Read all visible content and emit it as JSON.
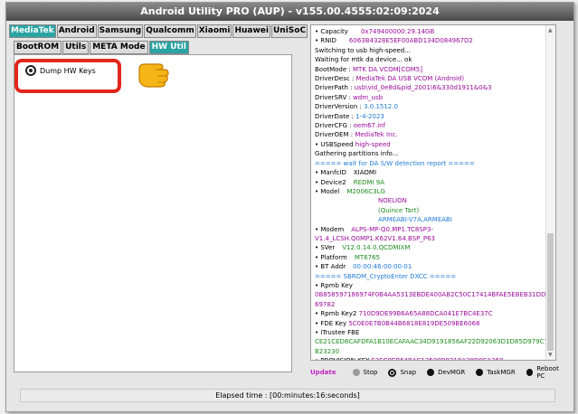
{
  "window": {
    "title": "Android Utility PRO (AUP) - v155.00.4555:02:09:2024"
  },
  "main_tabs": [
    {
      "label": "MediaTek",
      "active": true
    },
    {
      "label": "Android",
      "active": false
    },
    {
      "label": "Samsung",
      "active": false
    },
    {
      "label": "Qualcomm",
      "active": false
    },
    {
      "label": "Xiaomi",
      "active": false
    },
    {
      "label": "Huawei",
      "active": false
    },
    {
      "label": "UniSoC",
      "active": false
    }
  ],
  "sub_tabs": [
    {
      "label": "BootROM",
      "active": false
    },
    {
      "label": "Utils",
      "active": false
    },
    {
      "label": "META Mode",
      "active": false
    },
    {
      "label": "HW Util",
      "active": true
    }
  ],
  "hw_util": {
    "dump_hw_keys_label": "Dump HW Keys",
    "selected": true
  },
  "log": [
    {
      "parts": [
        {
          "t": "• Capacity",
          "c": "k"
        },
        {
          "t": "0x749400000:29.14GB",
          "c": "v",
          "tab": 2
        }
      ]
    },
    {
      "parts": [
        {
          "t": "• RNID",
          "c": "k"
        },
        {
          "t": "6063B4328E5EF00ABD134D084967D2",
          "c": "v",
          "tab": 2
        }
      ]
    },
    {
      "parts": [
        {
          "t": "Switching to usb high-speed...",
          "c": "k"
        }
      ]
    },
    {
      "parts": [
        {
          "t": "Waiting for mtk da device... ok",
          "c": "k"
        }
      ]
    },
    {
      "parts": [
        {
          "t": "BootMode : ",
          "c": "k"
        },
        {
          "t": "MTK DA VCOM[COM5]",
          "c": "v"
        }
      ]
    },
    {
      "parts": [
        {
          "t": "DriverDesc : ",
          "c": "k"
        },
        {
          "t": "MediaTek DA USB VCOM (Android)",
          "c": "v"
        }
      ]
    },
    {
      "parts": [
        {
          "t": "DriverPath : ",
          "c": "k"
        },
        {
          "t": "usb\\vid_0e8d&pid_2001\\6&330d1911&0&3",
          "c": "v"
        }
      ]
    },
    {
      "parts": [
        {
          "t": "DriverSRV : ",
          "c": "k"
        },
        {
          "t": "wdm_usb",
          "c": "v"
        }
      ]
    },
    {
      "parts": [
        {
          "t": "DriverVersion : ",
          "c": "k"
        },
        {
          "t": "3.0.1512.0",
          "c": "c"
        }
      ]
    },
    {
      "parts": [
        {
          "t": "DriverDate : ",
          "c": "k"
        },
        {
          "t": "1-4-2023",
          "c": "c"
        }
      ]
    },
    {
      "parts": [
        {
          "t": "DriverCFG : ",
          "c": "k"
        },
        {
          "t": "oem67.inf",
          "c": "v"
        }
      ]
    },
    {
      "parts": [
        {
          "t": "DriverOEM : ",
          "c": "k"
        },
        {
          "t": "MediaTek Inc.",
          "c": "v"
        }
      ]
    },
    {
      "parts": [
        {
          "t": "• USBSpeed ",
          "c": "k"
        },
        {
          "t": "high-speed",
          "c": "v"
        }
      ]
    },
    {
      "parts": [
        {
          "t": "Gathering partitions info...",
          "c": "k"
        }
      ]
    },
    {
      "parts": [
        {
          "t": "===== wait for DA S/W detection report =====",
          "c": "c"
        }
      ]
    },
    {
      "parts": [
        {
          "t": "• ManfcID",
          "c": "k"
        },
        {
          "t": "XIAOMI",
          "c": "k",
          "tab": 1
        }
      ]
    },
    {
      "parts": [
        {
          "t": "• Device2",
          "c": "k"
        },
        {
          "t": "REDMI 9A",
          "c": "g",
          "tab": 1
        }
      ]
    },
    {
      "parts": [
        {
          "t": "• Model",
          "c": "k"
        },
        {
          "t": "M2006C3LG",
          "c": "g",
          "tab": 1
        }
      ]
    },
    {
      "parts": [
        {
          "t": "NOELION",
          "c": "v",
          "tab": 3
        }
      ]
    },
    {
      "parts": [
        {
          "t": "(Quince Tart)",
          "c": "g",
          "tab": 3
        }
      ]
    },
    {
      "parts": [
        {
          "t": "ARMEABI-V7A,ARMEABI",
          "c": "c",
          "tab": 3
        }
      ]
    },
    {
      "parts": [
        {
          "t": "• Modem",
          "c": "k"
        },
        {
          "t": "ALPS-MP-Q0.MP1.TC8SP3-",
          "c": "v",
          "tab": 1
        }
      ]
    },
    {
      "parts": [
        {
          "t": "V1.4_LCSH.Q0MP1.K62V1.64.BSP_P63",
          "c": "v"
        }
      ]
    },
    {
      "parts": [
        {
          "t": "• SVer",
          "c": "k"
        },
        {
          "t": "V12.0.14.0.QCDMIXM",
          "c": "g",
          "tab": 1
        }
      ]
    },
    {
      "parts": [
        {
          "t": "• Platform",
          "c": "k"
        },
        {
          "t": "MT6765",
          "c": "g",
          "tab": 1
        }
      ]
    },
    {
      "parts": [
        {
          "t": "• BT Addr",
          "c": "k"
        },
        {
          "t": "00:00:46:00:00:01",
          "c": "c",
          "tab": 1
        }
      ]
    },
    {
      "parts": [
        {
          "t": "===== SBROM_CryptoEnter DXCC =====",
          "c": "c"
        }
      ]
    },
    {
      "parts": [
        {
          "t": "• Rpmb Key",
          "c": "k"
        }
      ]
    },
    {
      "parts": [
        {
          "t": "0B858597186974F0B4AA5313EBDE400AB2C50C17414BFAE5EBEB31DDC1A",
          "c": "v"
        }
      ]
    },
    {
      "parts": [
        {
          "t": "69782",
          "c": "v"
        }
      ]
    },
    {
      "parts": [
        {
          "t": "• Rpmb Key2 ",
          "c": "k"
        },
        {
          "t": "710D9DE99B6A65A88DCA041E7BC4E37C",
          "c": "v"
        }
      ]
    },
    {
      "parts": [
        {
          "t": "• FDE Key ",
          "c": "k"
        },
        {
          "t": "5C0E0E7B0B44B6818E819DE509BE6068",
          "c": "v"
        }
      ]
    },
    {
      "parts": [
        {
          "t": "• iTrustee FBE",
          "c": "k"
        }
      ]
    },
    {
      "parts": [
        {
          "t": "CE21CED8CAFDFA1B10ECAFAAC34D9191856AF22D92063D1D85D979C761",
          "c": "g"
        }
      ]
    },
    {
      "parts": [
        {
          "t": "B23230",
          "c": "g"
        }
      ]
    },
    {
      "parts": [
        {
          "t": "• PROVISION KEY ",
          "c": "k"
        },
        {
          "t": "F3EC9EB64BAC13509B8318A38D0EA268",
          "c": "v"
        }
      ]
    },
    {
      "parts": [
        {
          "t": "Rebooting device...",
          "c": "k"
        },
        {
          "t": "Done",
          "c": "c",
          "tab": 2
        }
      ]
    }
  ],
  "bottom": {
    "update_label": "Update",
    "options": [
      {
        "label": "Stop",
        "icon": "grey-dot-icon"
      },
      {
        "label": "Snap",
        "icon": "radio-dot-icon"
      },
      {
        "label": "DevMGR",
        "icon": "black-dot-icon"
      },
      {
        "label": "TaskMGR",
        "icon": "black-dot-icon"
      },
      {
        "label": "Reboot PC",
        "icon": "black-dot-icon"
      }
    ]
  },
  "status": {
    "elapsed": "Elapsed time : [00:minutes:16:seconds]"
  },
  "colors": {
    "accent": "#2aa3a3",
    "highlight": "#e1271c",
    "value": "#9b0a9b",
    "ok": "#1b8b1b",
    "info": "#1e7ad6"
  }
}
